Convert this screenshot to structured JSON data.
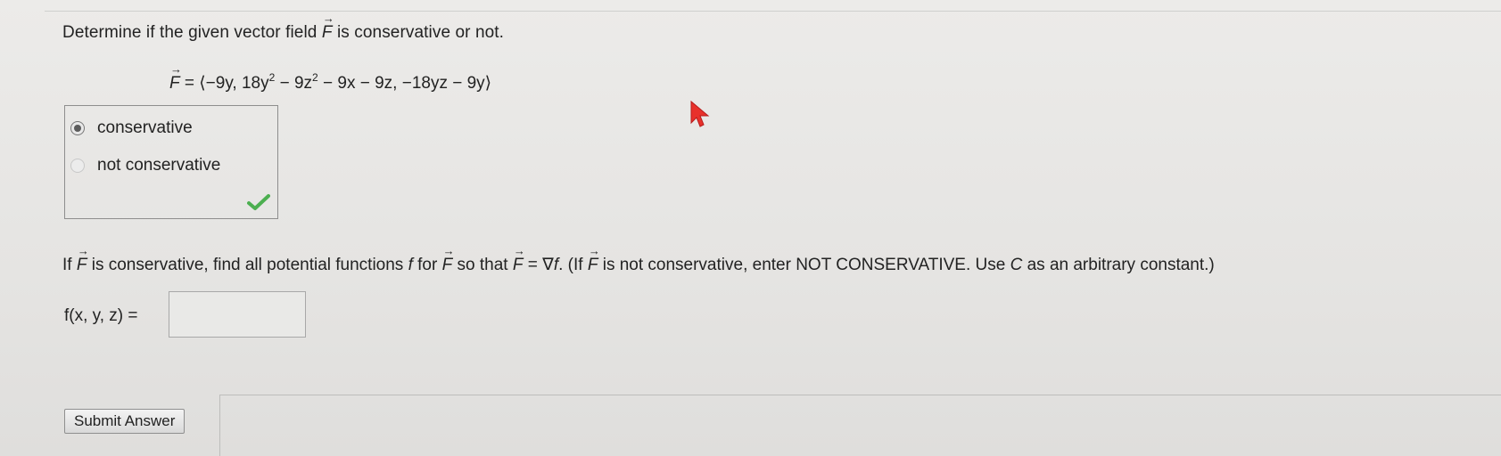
{
  "question": {
    "prefix": "Determine if the given vector field ",
    "vector_symbol": "F",
    "suffix": " is conservative or not."
  },
  "formula": {
    "lhs": "F",
    "eq": " = ⟨−9y, 18y",
    "exp1": "2",
    "part2": " − 9z",
    "exp2": "2",
    "part3": " − 9x − 9z, −18yz − 9y⟩"
  },
  "choices": [
    {
      "label": "conservative",
      "selected": true
    },
    {
      "label": "not conservative",
      "selected": false
    }
  ],
  "feedback": {
    "icon": "checkmark-icon",
    "color": "#4caf50"
  },
  "instructions": {
    "p1": "If ",
    "v1": "F",
    "p2": " is conservative, find all potential functions ",
    "f1": "f",
    "p3": " for ",
    "v2": "F",
    "p4": " so that ",
    "v3": "F",
    "p5": " = ∇",
    "f2": "f",
    "p6": ". (If ",
    "v4": "F",
    "p7": " is not conservative, enter NOT CONSERVATIVE. Use ",
    "c": "C",
    "p8": " as an arbitrary constant.)"
  },
  "answer": {
    "label": "f(x, y, z) = ",
    "value": ""
  },
  "submit": {
    "label": "Submit Answer"
  },
  "cursor": {
    "icon": "mouse-pointer-icon",
    "color": "#e8312b"
  }
}
